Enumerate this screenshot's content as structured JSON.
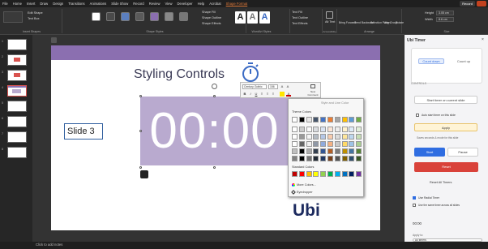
{
  "menu": {
    "items": [
      "File",
      "Home",
      "Insert",
      "Draw",
      "Design",
      "Transitions",
      "Animations",
      "Slide Show",
      "Record",
      "Review",
      "View",
      "Developer",
      "Help",
      "Acrobat",
      "Shape Format"
    ],
    "record_label": "Record"
  },
  "ribbon": {
    "edit_shape": "Edit Shape",
    "text_box": "Text Box",
    "insert_shapes": "Insert Shapes",
    "shape_styles": "Shape Styles",
    "shape_fill": "Shape Fill",
    "shape_outline": "Shape Outline",
    "shape_effects": "Shape Effects",
    "wordart_styles": "WordArt Styles",
    "text_fill": "Text Fill",
    "text_outline": "Text Outline",
    "text_effects": "Text Effects",
    "alt_text": "Alt Text",
    "accessibility": "Accessibility",
    "bring_forward": "Bring Forward",
    "send_backward": "Send Backward",
    "selection_pane": "Selection Pane",
    "align": "Align",
    "group": "Group",
    "rotate": "Rotate",
    "arrange": "Arrange",
    "height_label": "Height",
    "height_value": "3.05 cm",
    "width_label": "Width",
    "width_value": "8.6 cm",
    "size": "Size",
    "swatch_colors": [
      "#ffffff",
      "#4a4a4a",
      "#5b7fbf",
      "#5a5a5a",
      "#8b6fb0",
      "#888888",
      "#777777"
    ]
  },
  "slides": {
    "numbers": [
      "1",
      "2",
      "3",
      "4",
      "5",
      "6",
      "7",
      "8"
    ]
  },
  "slide": {
    "title": "Styling Controls",
    "timer": "00:00",
    "slide_label": "Slide 3",
    "logo": "Ubi"
  },
  "mini_toolbar": {
    "font": "Century Gothic",
    "size": "156",
    "new_comment": "New Comment"
  },
  "picker": {
    "header": "Style and Line Color",
    "theme_colors": "Theme Colors",
    "standard_colors": "Standard Colors",
    "more_colors": "More Colors...",
    "eyedropper": "Eyedropper",
    "theme_top": [
      "#ffffff",
      "#000000",
      "#e7e6e6",
      "#44546a",
      "#4472c4",
      "#ed7d31",
      "#a5a5a5",
      "#ffc000",
      "#5b9bd5",
      "#70ad47"
    ],
    "standard": [
      "#c00000",
      "#ff0000",
      "#ffc000",
      "#ffff00",
      "#92d050",
      "#00b050",
      "#00b0f0",
      "#0070c0",
      "#002060",
      "#7030a0"
    ]
  },
  "status": {
    "notes": "Click to add notes"
  },
  "pane": {
    "title": "Ubi Timer",
    "tab_countdown": "Count down",
    "tab_countup": "Count up",
    "controls": "CONTROLS",
    "start_on_slide": "Start timer on current slide",
    "auto_start": "Auto start timer on this slide",
    "apply": "Apply",
    "saves_note": "Saves seconds & mode for this slide",
    "start": "Start",
    "pause": "Pause",
    "reset": "Reset",
    "reset_all": "Reset All Timers",
    "use_radial": "Use Radial Timer",
    "use_same_timer": "Use the same timer across all slides",
    "time_readout": "00:00",
    "apply_to": "Apply to:",
    "all_timers": "All timers",
    "accent": "#2f6de1",
    "reset_color": "#d9423a"
  }
}
